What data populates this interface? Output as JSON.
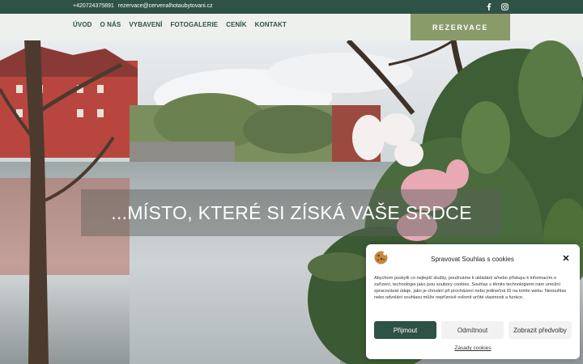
{
  "topbar": {
    "phone": "+420724375891",
    "email": "rezervace@cervenalhotaubytovani.cz",
    "facebook_icon": "facebook-icon",
    "instagram_icon": "instagram-icon"
  },
  "nav": {
    "items": [
      {
        "label": "ÚVOD"
      },
      {
        "label": "O NÁS"
      },
      {
        "label": "VYBAVENÍ"
      },
      {
        "label": "FOTOGALERIE"
      },
      {
        "label": "CENÍK"
      },
      {
        "label": "KONTAKT"
      }
    ],
    "cta": "REZERVACE"
  },
  "hero": {
    "tagline": "...MÍSTO, KTERÉ SI ZÍSKÁ VAŠE SRDCE"
  },
  "cookie": {
    "title": "Spravovat Souhlas s cookies",
    "text": "Abychom poskytli co nejlepší služby, používáme k ukládání a/nebo přístupu k informacím o zařízení, technologie jako jsou soubory cookies. Souhlas s těmito technologiemi nám umožní zpracovávat údaje, jako je chování při procházení nebo jedinečná ID na tomto webu. Nesouhlas nebo odvolání souhlasu může nepříznivě ovlivnit určité vlastnosti a funkce.",
    "accept": "Přijmout",
    "deny": "Odmítnout",
    "preferences": "Zobrazit předvolby",
    "policy": "Zásady cookies",
    "close_icon": "close-icon",
    "logo_icon": "cookie-icon"
  },
  "colors": {
    "brand_green": "#2f5246",
    "cta_olive": "#8a9b6a"
  }
}
